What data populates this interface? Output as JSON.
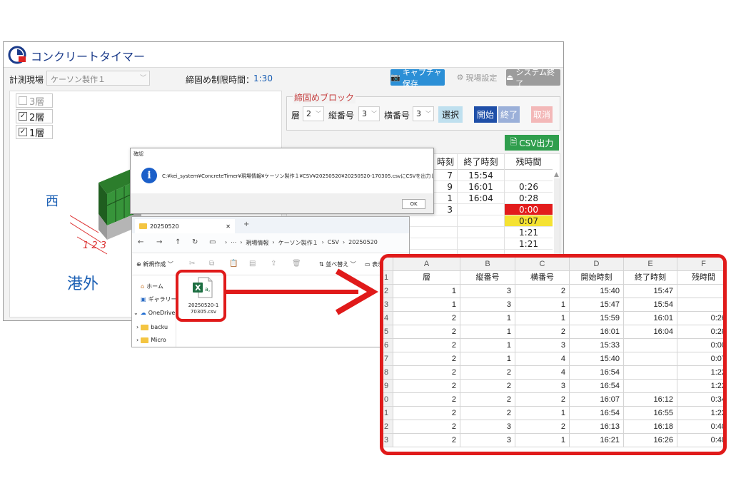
{
  "app": {
    "title": "コンクリートタイマー",
    "site_label": "計測現場",
    "site_value": "ケーソン製作１",
    "limit_label": "締固め制限時間：",
    "limit_value": "1:30",
    "capture_label": "キャプチャ保存",
    "site_settings_label": "現場設定",
    "exit_label": "システム終了"
  },
  "floors": [
    {
      "label": "3層",
      "checked": false
    },
    {
      "label": "2層",
      "checked": true
    },
    {
      "label": "1層",
      "checked": true
    }
  ],
  "view_labels": {
    "west": "西",
    "port_outside": "港外"
  },
  "block": {
    "title": "締固めブロック",
    "floor_label": "層",
    "floor_value": "2",
    "row_label": "縦番号",
    "row_value": "3",
    "col_label": "横番号",
    "col_value": "3",
    "select_label": "選択",
    "start_label": "開始",
    "end_label": "終了",
    "cancel_label": "取消"
  },
  "csv_button": "CSV出力",
  "result_table": {
    "headers": [
      "時刻",
      "終了時刻",
      "残時間"
    ],
    "col1": [
      "7",
      "9",
      "1",
      "3",
      "",
      "",
      "",
      "",
      ""
    ],
    "col2": [
      "15:54",
      "16:01",
      "16:04",
      "",
      "",
      "",
      "",
      "",
      ""
    ],
    "col3": [
      "",
      "0:26",
      "0:28",
      "0:00",
      "0:07",
      "1:21",
      "1:21",
      "",
      ""
    ]
  },
  "dialog": {
    "title": "確認",
    "message": "C:¥kei_system¥ConcreteTimer¥現場情報¥ケーソン製作１¥CSV¥20250520¥20250520-170305.csvにCSVを出力しました。",
    "ok_label": "OK"
  },
  "explorer": {
    "tab_label": "20250520",
    "breadcrumb": [
      "現場情報",
      "ケーソン製作１",
      "CSV",
      "20250520"
    ],
    "new_label": "新規作成",
    "sort_label": "並べ替え",
    "view_label": "表示",
    "sidebar": [
      "ホーム",
      "ギャラリー",
      "OneDrive",
      "backu",
      "Micro"
    ],
    "file_name_line1": "20250520-1",
    "file_name_line2": "70305.csv"
  },
  "spreadsheet": {
    "columns": [
      "A",
      "B",
      "C",
      "D",
      "E",
      "F"
    ],
    "headers": [
      "層",
      "縦番号",
      "横番号",
      "開始時刻",
      "終了時刻",
      "残時間"
    ],
    "row_numbers": [
      "1",
      "2",
      "3",
      "4",
      "5",
      "6",
      "7",
      "8",
      "9",
      "0",
      "1",
      "2",
      "3"
    ],
    "rows": [
      [
        "1",
        "3",
        "2",
        "15:40",
        "15:47",
        ""
      ],
      [
        "1",
        "3",
        "1",
        "15:47",
        "15:54",
        ""
      ],
      [
        "2",
        "1",
        "1",
        "15:59",
        "16:01",
        "0:26"
      ],
      [
        "2",
        "1",
        "2",
        "16:01",
        "16:04",
        "0:28"
      ],
      [
        "2",
        "1",
        "3",
        "15:33",
        "",
        "0:00"
      ],
      [
        "2",
        "1",
        "4",
        "15:40",
        "",
        "0:07"
      ],
      [
        "2",
        "2",
        "4",
        "16:54",
        "",
        "1:22"
      ],
      [
        "2",
        "2",
        "3",
        "16:54",
        "",
        "1:22"
      ],
      [
        "2",
        "2",
        "2",
        "16:07",
        "16:12",
        "0:34"
      ],
      [
        "2",
        "2",
        "1",
        "16:54",
        "16:55",
        "1:22"
      ],
      [
        "2",
        "3",
        "2",
        "16:13",
        "16:18",
        "0:40"
      ],
      [
        "2",
        "3",
        "1",
        "16:21",
        "16:26",
        "0:48"
      ]
    ]
  }
}
